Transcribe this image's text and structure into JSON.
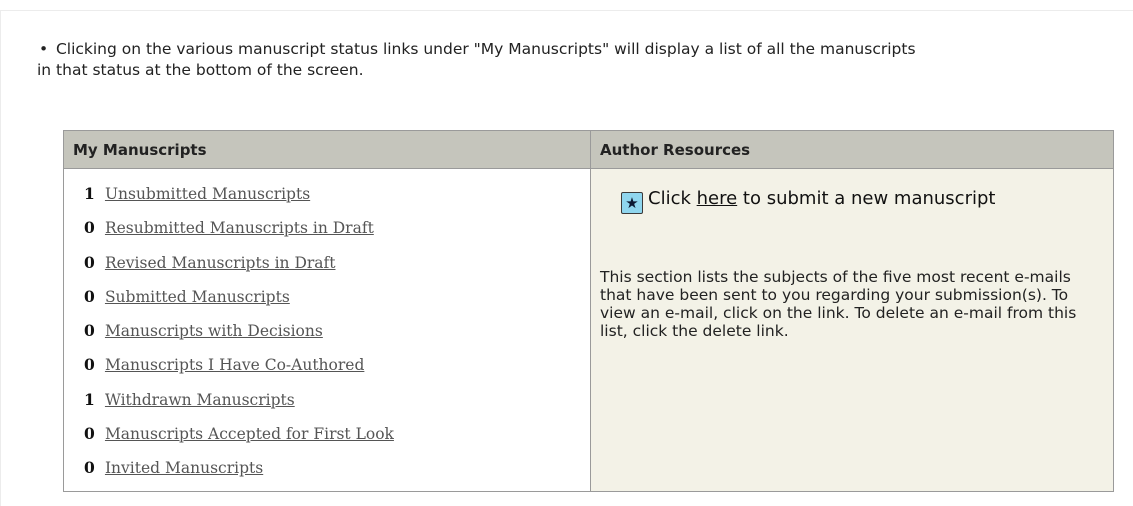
{
  "intro": {
    "bullet": "•",
    "text_line1": "Clicking on the various manuscript status links under \"My Manuscripts\" will display a list of all the manuscripts",
    "text_line2": "in that status at the bottom of the screen."
  },
  "my_manuscripts": {
    "header": "My Manuscripts",
    "items": [
      {
        "count": "1",
        "label": "Unsubmitted Manuscripts"
      },
      {
        "count": "0",
        "label": "Resubmitted Manuscripts in Draft"
      },
      {
        "count": "0",
        "label": "Revised Manuscripts in Draft"
      },
      {
        "count": "0",
        "label": "Submitted Manuscripts"
      },
      {
        "count": "0",
        "label": "Manuscripts with Decisions"
      },
      {
        "count": "0",
        "label": "Manuscripts I Have Co-Authored"
      },
      {
        "count": "1",
        "label": "Withdrawn Manuscripts"
      },
      {
        "count": "0",
        "label": "Manuscripts Accepted for First Look"
      },
      {
        "count": "0",
        "label": "Invited Manuscripts"
      }
    ]
  },
  "author_resources": {
    "header": "Author Resources",
    "submit": {
      "icon": "star-icon",
      "prefix": "Click",
      "link_text": "here",
      "suffix": "to submit a new manuscript"
    },
    "description": "This section lists the subjects of the five most recent e-mails that have been sent to you regarding your submission(s). To view an e-mail, click on the link. To delete an e-mail from this list, click the delete link."
  },
  "colors": {
    "header_bg": "#c5c5bc",
    "resources_bg": "#f3f2e7",
    "link_gray": "#555555",
    "star_icon_bg": "#8fd6ee"
  }
}
